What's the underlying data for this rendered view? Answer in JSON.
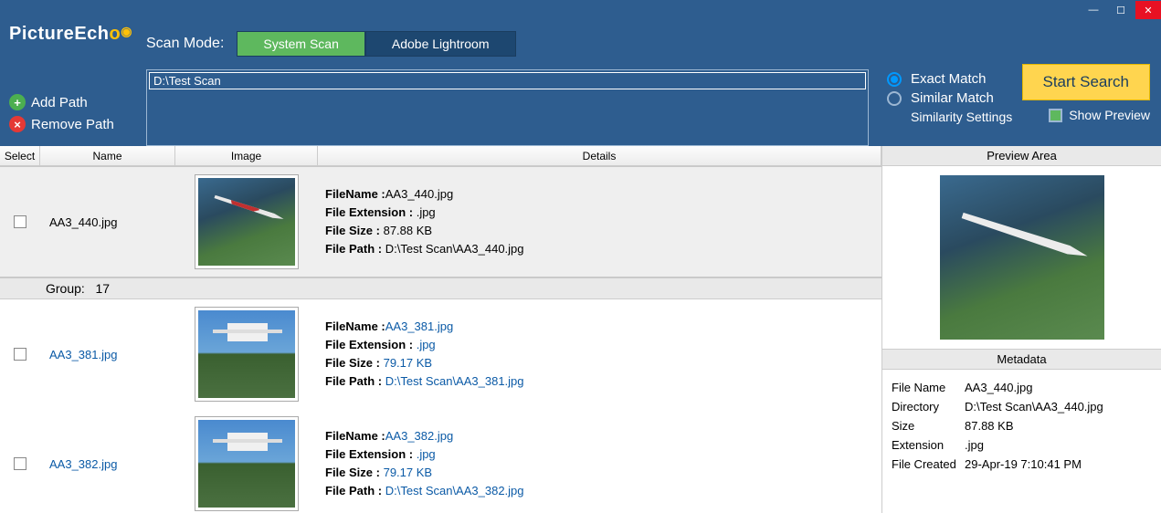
{
  "app": {
    "name_a": "Picture",
    "name_b": "Ech",
    "name_c": "o"
  },
  "window": {
    "minimize": "—",
    "maximize": "☐",
    "close": "✕"
  },
  "sidebar": {
    "add_path": "Add Path",
    "remove_path": "Remove Path"
  },
  "scan_mode": {
    "label": "Scan Mode:",
    "system": "System Scan",
    "lightroom": "Adobe Lightroom"
  },
  "paths": {
    "entry": "D:\\Test Scan"
  },
  "match": {
    "exact": "Exact Match",
    "similar": "Similar Match",
    "settings": "Similarity Settings"
  },
  "start_btn": "Start Search",
  "show_preview": "Show Preview",
  "columns": {
    "select": "Select",
    "name": "Name",
    "image": "Image",
    "details": "Details"
  },
  "labels": {
    "filename": "FileName :",
    "ext": "File Extension :",
    "size": "File Size :",
    "path": "File Path  :"
  },
  "group": {
    "label": "Group:",
    "num": "17"
  },
  "rows": [
    {
      "name": "AA3_440.jpg",
      "filename": "AA3_440.jpg",
      "ext": ".jpg",
      "size": "87.88 KB",
      "path": "D:\\Test Scan\\AA3_440.jpg",
      "selected": true,
      "thumb": "plane1"
    },
    {
      "name": "AA3_381.jpg",
      "filename": "AA3_381.jpg",
      "ext": ".jpg",
      "size": "79.17 KB",
      "path": "D:\\Test Scan\\AA3_381.jpg",
      "selected": false,
      "thumb": "plane2"
    },
    {
      "name": "AA3_382.jpg",
      "filename": "AA3_382.jpg",
      "ext": ".jpg",
      "size": "79.17 KB",
      "path": "D:\\Test Scan\\AA3_382.jpg",
      "selected": false,
      "thumb": "plane2"
    }
  ],
  "preview": {
    "area_title": "Preview Area",
    "meta_title": "Metadata"
  },
  "metadata": {
    "filename_lbl": "File Name",
    "filename": "AA3_440.jpg",
    "dir_lbl": "Directory",
    "dir": "D:\\Test Scan\\AA3_440.jpg",
    "size_lbl": "Size",
    "size": "87.88 KB",
    "ext_lbl": "Extension",
    "ext": ".jpg",
    "created_lbl": "File Created",
    "created": "29-Apr-19 7:10:41 PM"
  }
}
